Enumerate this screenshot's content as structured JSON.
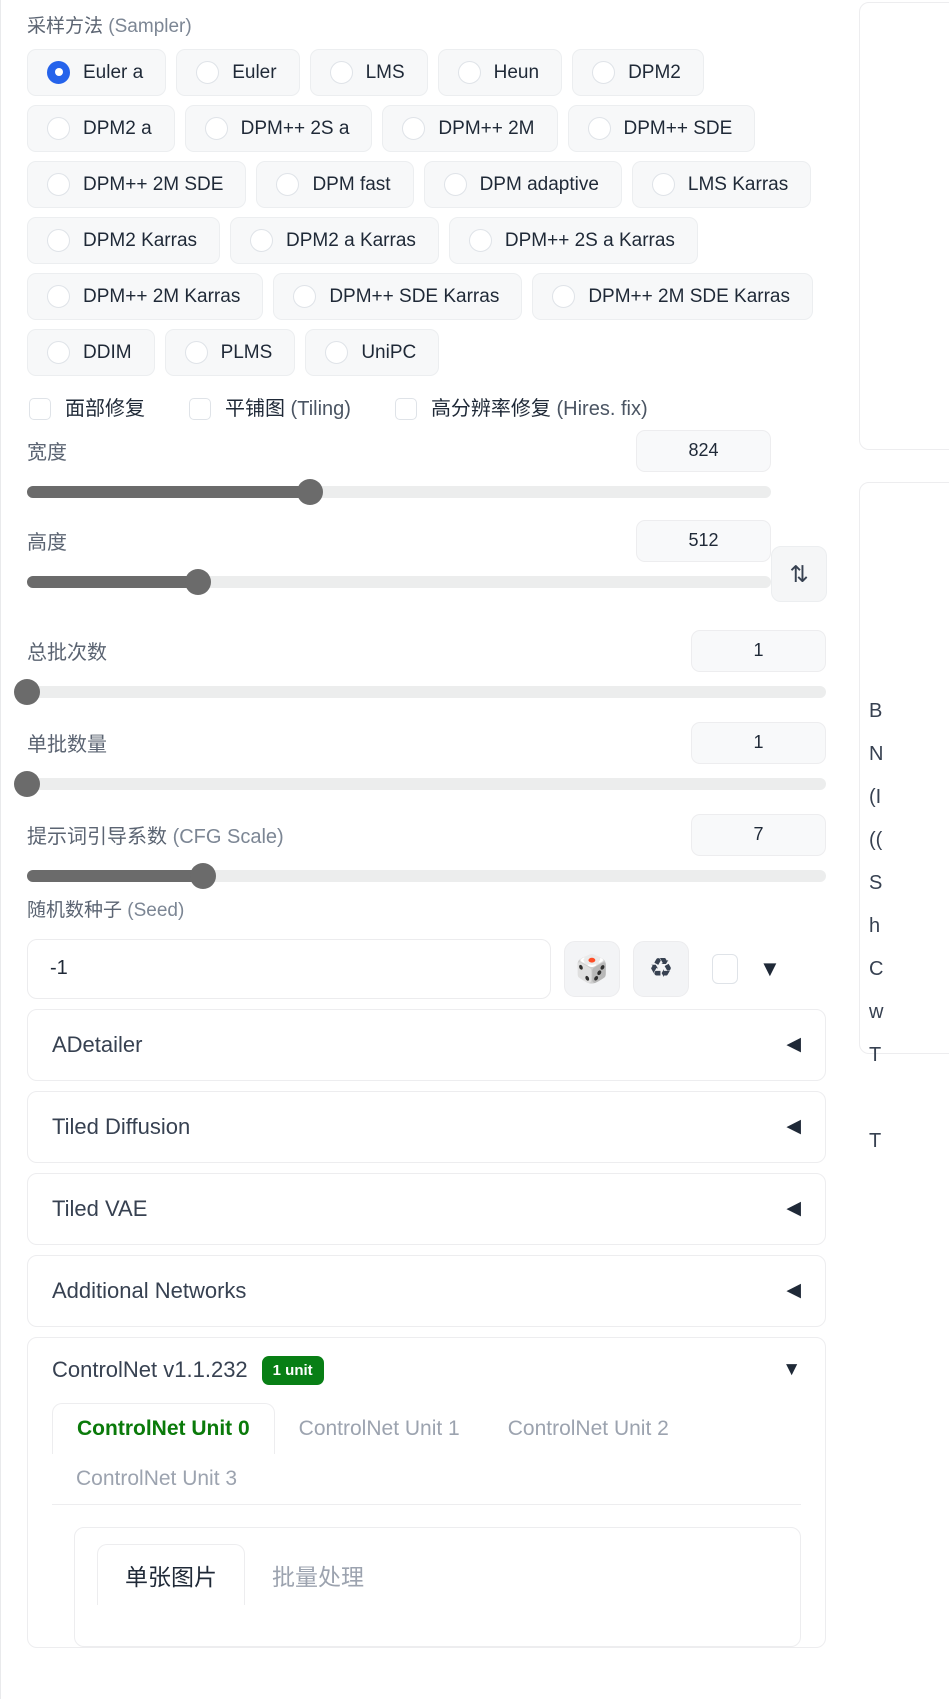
{
  "sampler": {
    "label_cn": "采样方法",
    "label_en": "(Sampler)",
    "selected": "Euler a",
    "options": [
      "Euler a",
      "Euler",
      "LMS",
      "Heun",
      "DPM2",
      "DPM2 a",
      "DPM++ 2S a",
      "DPM++ 2M",
      "DPM++ SDE",
      "DPM++ 2M SDE",
      "DPM fast",
      "DPM adaptive",
      "LMS Karras",
      "DPM2 Karras",
      "DPM2 a Karras",
      "DPM++ 2S a Karras",
      "DPM++ 2M Karras",
      "DPM++ SDE Karras",
      "DPM++ 2M SDE Karras",
      "DDIM",
      "PLMS",
      "UniPC"
    ]
  },
  "checkboxes": [
    {
      "label_cn": "面部修复",
      "label_en": "",
      "checked": false
    },
    {
      "label_cn": "平铺图",
      "label_en": "(Tiling)",
      "checked": false
    },
    {
      "label_cn": "高分辨率修复",
      "label_en": "(Hires. fix)",
      "checked": false
    }
  ],
  "sliders": {
    "width": {
      "label_cn": "宽度",
      "label_en": "",
      "value": "824",
      "percent": 38
    },
    "height": {
      "label_cn": "高度",
      "label_en": "",
      "value": "512",
      "percent": 23
    },
    "batch_count": {
      "label_cn": "总批次数",
      "label_en": "",
      "value": "1",
      "percent": 0
    },
    "batch_size": {
      "label_cn": "单批数量",
      "label_en": "",
      "value": "1",
      "percent": 0
    },
    "cfg_scale": {
      "label_cn": "提示词引导系数",
      "label_en": "(CFG Scale)",
      "value": "7",
      "percent": 22
    }
  },
  "swap_button": {
    "icon": "swap-vertical-icon",
    "glyph": "⇅"
  },
  "seed": {
    "label_cn": "随机数种子",
    "label_en": "(Seed)",
    "value": "-1",
    "placeholder": "",
    "dice_icon": "dice-icon",
    "dice_glyph": "🎲",
    "recycle_icon": "recycle-icon",
    "recycle_glyph": "♻",
    "extra_checked": false,
    "caret_glyph": "▼"
  },
  "accordions": [
    {
      "title": "ADetailer",
      "caret": "◀",
      "open": false
    },
    {
      "title": "Tiled Diffusion",
      "caret": "◀",
      "open": false
    },
    {
      "title": "Tiled VAE",
      "caret": "◀",
      "open": false
    },
    {
      "title": "Additional Networks",
      "caret": "◀",
      "open": false
    }
  ],
  "controlnet": {
    "title": "ControlNet v1.1.232",
    "badge": "1 unit",
    "caret": "▼",
    "badge_color": "#087f15",
    "active_color": "#0a7a0a",
    "tabs": [
      {
        "label": "ControlNet Unit 0",
        "active": true
      },
      {
        "label": "ControlNet Unit 1",
        "active": false
      },
      {
        "label": "ControlNet Unit 2",
        "active": false
      },
      {
        "label": "ControlNet Unit 3",
        "active": false
      }
    ],
    "inner_tabs": [
      {
        "label": "单张图片",
        "active": true
      },
      {
        "label": "批量处理",
        "active": false
      }
    ]
  },
  "right_panel": {
    "lines": [
      "B",
      "N",
      "(I",
      "((",
      "S",
      "h",
      "C",
      "w",
      "T",
      "",
      "T"
    ]
  },
  "colors": {
    "accent_blue": "#2563eb",
    "green": "#087f15",
    "slider_fill": "#6b6b6b",
    "track": "#eceded"
  }
}
